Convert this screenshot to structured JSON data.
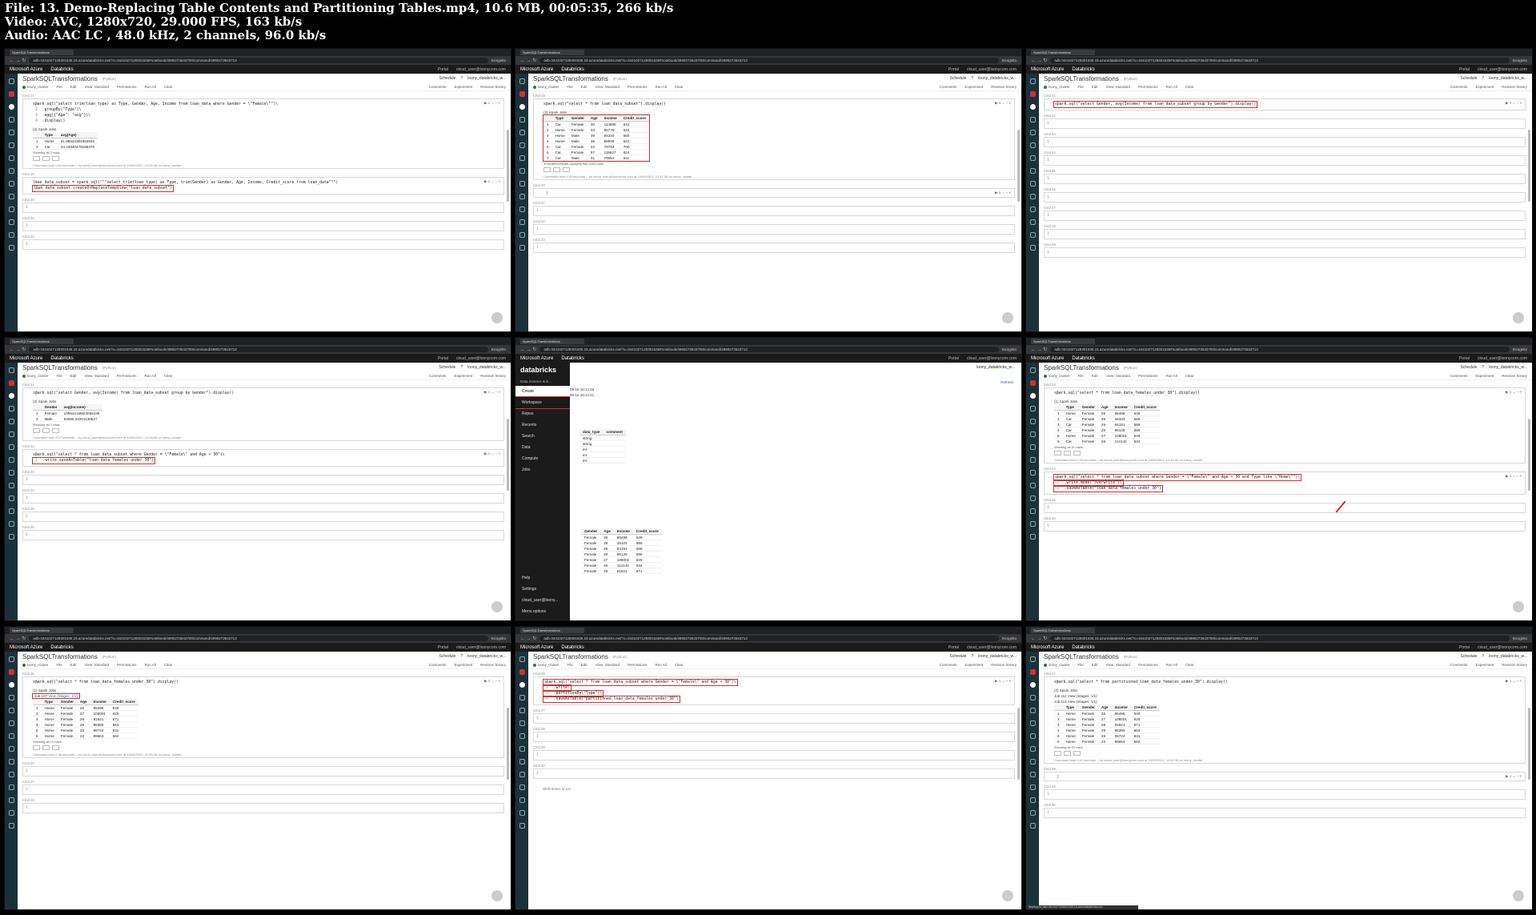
{
  "file_info": {
    "line1": "File: 13. Demo-Replacing Table Contents and Partitioning Tables.mp4, 10.6 MB, 00:05:35, 266 kb/s",
    "line2": "Video: AVC, 1280x720, 29.000 FPS, 163 kb/s",
    "line3": "Audio: AAC LC , 48.0 kHz, 2 channels, 96.0 kb/s"
  },
  "chrome": {
    "tab_title": "SparkSQLTransformations",
    "url": "adb-3441027128301535.15.azuredatabricks.net/?o=3441027128301535#notebook/4990273643700/command/4990273643713",
    "incognito": "Incognito",
    "azure": "Microsoft Azure",
    "databricks": "Databricks",
    "portal": "Portal",
    "user_email": "cloud_user@loonycorn.com"
  },
  "notebook": {
    "title": "SparkSQLTransformations",
    "lang": "(Python)",
    "schedule": "Schedule",
    "help": "?",
    "user": "loony_databricks_w...",
    "cluster": "loony_cluster",
    "file": "File",
    "edit": "Edit",
    "view": "View: Standard",
    "permissions": "Permissions",
    "run_all": "Run All",
    "clear": "Clear",
    "comments": "Comments",
    "experiment": "Experiment",
    "revision": "Revision history"
  },
  "frames": [
    {
      "cells": [
        {
          "no": "Cmd 17",
          "lines": [
            "spark.sql(\"select trim(loan_type) as Type, Gender, Age, Income from loan_data where Gender = \\\"Female\\\"\")\\",
            "    .groupBy(\"Type\")\\",
            "    .agg({\"Age\": \"avg\"})\\",
            "    .display()"
          ],
          "jobs": "(2) Spark Jobs",
          "table": {
            "headers": [
              "",
              "Type",
              "avg(Age)"
            ],
            "rows": [
              [
                "1",
                "Home",
                "41.88544384383634"
              ],
              [
                "2",
                "Car",
                "44.44840478186476"
              ]
            ]
          },
          "showing": "Showing all 2 rows.",
          "info": "Command took 0.64 seconds -- by cloud_user@loonycorn.com at 15/09/2021, 12:09:16 on loony_cluster"
        },
        {
          "no": "Cmd 18",
          "lines": [
            "loan_data_subset = spark.sql(\"\"\"select trim(loan_type) as Type, trim(Gender) as Gender, Age, Income, Credit_score from loan_data\"\"\")",
            "",
            "loan_data_subset.createOrReplaceTempView(\"loan_data_subset\")"
          ],
          "hl": 2
        },
        {
          "no": "Cmd 19"
        },
        {
          "no": "Cmd 20"
        },
        {
          "no": "Cmd 21"
        }
      ]
    },
    {
      "cells": [
        {
          "no": "Cmd 19",
          "lines": [
            "spark.sql(\"select * from loan_data_subset\").display()"
          ],
          "jobs": "(2) Spark Jobs",
          "table": {
            "boxed": true,
            "headers": [
              "",
              "Type",
              "Gender",
              "Age",
              "Income",
              "Credit_score"
            ],
            "rows": [
              [
                "1",
                "Car",
                "Female",
                "30",
                "114885",
                "641"
              ],
              [
                "2",
                "Home",
                "Female",
                "43",
                "95775",
                "534"
              ],
              [
                "3",
                "Home",
                "Male",
                "39",
                "84220",
                "558"
              ],
              [
                "4",
                "Home",
                "Male",
                "35",
                "58946",
                "622"
              ],
              [
                "5",
                "Car",
                "Female",
                "42",
                "79754",
                "700"
              ],
              [
                "6",
                "Car",
                "Female",
                "57",
                "119627",
                "624"
              ],
              [
                "7",
                "Car",
                "Male",
                "41",
                "79051",
                "611"
              ]
            ]
          },
          "showing": "Truncated results, showing first 1000 rows.",
          "info": "Command took 0.34 seconds -- by cloud_user@loonycorn.com at 15/09/2021, 12:41:36 on loony_cluster"
        },
        {
          "no": "Cmd 20",
          "lines": [
            ""
          ]
        },
        {
          "no": "Cmd 21"
        },
        {
          "no": "Cmd 22"
        },
        {
          "no": "Cmd 23"
        }
      ]
    },
    {
      "cells": [
        {
          "no": "Cmd 21",
          "lines": [
            "spark.sql(\"select Gender, avg(Income) from loan_data_subset group by Gender\").display()"
          ],
          "hl": 0
        },
        {
          "no": "Cmd 22"
        },
        {
          "no": "Cmd 23"
        },
        {
          "no": "Cmd 24"
        },
        {
          "no": "Cmd 25"
        },
        {
          "no": "Cmd 26"
        },
        {
          "no": "Cmd 27"
        },
        {
          "no": "Cmd 28"
        },
        {
          "no": "Cmd 29"
        }
      ]
    },
    {
      "cells": [
        {
          "no": "Cmd 21",
          "lines": [
            "spark.sql(\"select Gender, avg(Income) from loan_data_subset group by Gender\").display()"
          ],
          "jobs": "(2) Spark Jobs",
          "table": {
            "headers": [
              "",
              "Gender",
              "avg(Income)"
            ],
            "rows": [
              [
                "1",
                "Female",
                "100644.58603066439"
              ],
              [
                "2",
                "Male",
                "93080.44201136527"
              ]
            ]
          },
          "showing": "Showing all 2 rows.",
          "info": "Command took 0.27 seconds -- by cloud_user@loonycorn.com at 15/09/2021, 12:45:46 on loony_cluster"
        },
        {
          "no": "Cmd 22",
          "lines": [
            "spark.sql(\"select * from loan_data_subset where Gender = \\\"Female\\\" and Age < 30\")\\",
            "    .write.saveAsTable(\"loan_data_females_under_30\")"
          ],
          "hl": 1
        },
        {
          "no": "Cmd 23"
        },
        {
          "no": "Cmd 24"
        },
        {
          "no": "Cmd 25"
        },
        {
          "no": "Cmd 26"
        }
      ]
    },
    {
      "sidebar": {
        "logo": "databricks",
        "env": "Data Science & E...",
        "items": [
          "Create",
          "Workspace",
          "Repos",
          "Recents",
          "Search",
          "Data",
          "Compute",
          "Jobs"
        ],
        "bottom": [
          "Help",
          "Settings",
          "cloud_user@loony...",
          "Menu options"
        ]
      },
      "refresh": "Refresh",
      "times": [
        "09-15 10:14:18",
        "09-15 10:14:21"
      ],
      "schema": {
        "headers": [
          "data_type",
          "comment"
        ],
        "rows": [
          [
            "string",
            ""
          ],
          [
            "string",
            ""
          ],
          [
            "int",
            ""
          ],
          [
            "int",
            ""
          ],
          [
            "int",
            ""
          ]
        ]
      },
      "table": {
        "headers": [
          "Gender",
          "Age",
          "Income",
          "Credit_score"
        ],
        "rows": [
          [
            "Female",
            "26",
            "85496",
            "649"
          ],
          [
            "Female",
            "29",
            "45103",
            "585"
          ],
          [
            "Female",
            "29",
            "84191",
            "588"
          ],
          [
            "Female",
            "28",
            "95128",
            "586"
          ],
          [
            "Female",
            "27",
            "108001",
            "626"
          ],
          [
            "Female",
            "29",
            "114142",
            "534"
          ],
          [
            "Female",
            "28",
            "81821",
            "671"
          ]
        ]
      }
    },
    {
      "cells": [
        {
          "no": "Cmd 23",
          "lines": [
            "spark.sql(\"select * from loan_data_females_under_30\").display()"
          ],
          "jobs": "(1) Spark Jobs",
          "table": {
            "headers": [
              "",
              "Type",
              "Gender",
              "Age",
              "Income",
              "Credit_score"
            ],
            "rows": [
              [
                "1",
                "Home",
                "Female",
                "26",
                "85496",
                "649"
              ],
              [
                "2",
                "Car",
                "Female",
                "29",
                "45103",
                "585"
              ],
              [
                "3",
                "Car",
                "Female",
                "29",
                "84191",
                "588"
              ],
              [
                "4",
                "Car",
                "Female",
                "28",
                "95128",
                "586"
              ],
              [
                "5",
                "Home",
                "Female",
                "27",
                "108001",
                "626"
              ],
              [
                "6",
                "Car",
                "Female",
                "29",
                "114142",
                "534"
              ]
            ]
          },
          "showing": "Showing all 21 rows.",
          "info": "Command took 0.43 seconds -- by cloud_user@loonycorn.com at 15/09/2021, 12:49:00 on loony_cluster"
        },
        {
          "no": "Cmd 24",
          "lines": [
            "spark.sql(\"select * from loan_data_subset where Gender = \\\"Female\\\" and Age < 30 and Type like \\\"Home\\\"\")\\",
            "    .write.mode(\"overwrite\")\\",
            "    .saveAsTable(\"loan_data_females_under_30\")"
          ],
          "hlall": true
        },
        {
          "no": "Cmd 25"
        },
        {
          "no": "Cmd 26"
        }
      ]
    },
    {
      "cells": [
        {
          "no": "Cmd 25",
          "lines": [
            "spark.sql(\"select * from loan_data_females_under_30\").display()"
          ],
          "jobs": "(1) Spark Jobs",
          "job_line": "Job 107",
          "job_link": "View (Stages: 1/1)",
          "table": {
            "headers": [
              "",
              "Type",
              "Gender",
              "Age",
              "Income",
              "Credit_score"
            ],
            "rows": [
              [
                "1",
                "Home",
                "Female",
                "26",
                "85496",
                "649"
              ],
              [
                "2",
                "Home",
                "Female",
                "27",
                "108001",
                "626"
              ],
              [
                "3",
                "Home",
                "Female",
                "28",
                "81821",
                "671"
              ],
              [
                "4",
                "Home",
                "Female",
                "29",
                "95380",
                "563"
              ],
              [
                "5",
                "Home",
                "Female",
                "28",
                "96724",
                "631"
              ],
              [
                "6",
                "Home",
                "Female",
                "23",
                "89663",
                "562"
              ]
            ]
          },
          "showing": "Showing all 13 rows.",
          "info": "Command took 0.48 seconds -- by cloud_user@loonycorn.com at 15/09/2021, 12:49:28 on loony_cluster"
        },
        {
          "no": "Cmd 26"
        },
        {
          "no": "Cmd 27"
        },
        {
          "no": "Cmd 28"
        }
      ]
    },
    {
      "cells": [
        {
          "no": "Cmd 26",
          "lines": [
            "spark.sql(\"select * from loan_data_subset where Gender = \\\"Female\\\" and Age < 30\")\\",
            "    .write\\",
            "    .partitionBy(\"Type\")\\",
            "    .saveAsTable(\"partitioned_loan_data_females_under_30\")"
          ],
          "hlall": true
        },
        {
          "no": "Cmd 27"
        },
        {
          "no": "Cmd 28"
        },
        {
          "no": "Cmd 29"
        },
        {
          "no": "Cmd 30"
        }
      ],
      "status": "Shift+Enter to run"
    },
    {
      "cells": [
        {
          "no": "Cmd 27",
          "lines": [
            "spark.sql(\"select * from partitioned_loan_data_females_under_30\").display()"
          ],
          "jobs": "(2) Spark Jobs",
          "job_lines": [
            "Job 112   View (Stages: 1/1)",
            "Job 113   View (Stages: 1/1)"
          ],
          "table": {
            "headers": [
              "",
              "Type",
              "Gender",
              "Age",
              "Income",
              "Credit_score"
            ],
            "rows": [
              [
                "1",
                "Home",
                "Female",
                "26",
                "85496",
                "649"
              ],
              [
                "2",
                "Home",
                "Female",
                "27",
                "108001",
                "626"
              ],
              [
                "3",
                "Home",
                "Female",
                "28",
                "81821",
                "671"
              ],
              [
                "4",
                "Home",
                "Female",
                "29",
                "95380",
                "563"
              ],
              [
                "5",
                "Home",
                "Female",
                "28",
                "96724",
                "631"
              ],
              [
                "6",
                "Home",
                "Female",
                "23",
                "89663",
                "562"
              ]
            ]
          },
          "showing": "Showing all 21 rows.",
          "info": "Command took 0.61 seconds -- by cloud_user@loonycorn.com at 15/09/2021, 12:52:30 on loony_cluster"
        },
        {
          "no": "Cmd 28",
          "lines": [
            ""
          ]
        },
        {
          "no": "Cmd 29"
        },
        {
          "no": "Cmd 30"
        }
      ],
      "bottom_url": "Waiting for adb-3441027128301535.15.azuredatabricks.net..."
    }
  ]
}
